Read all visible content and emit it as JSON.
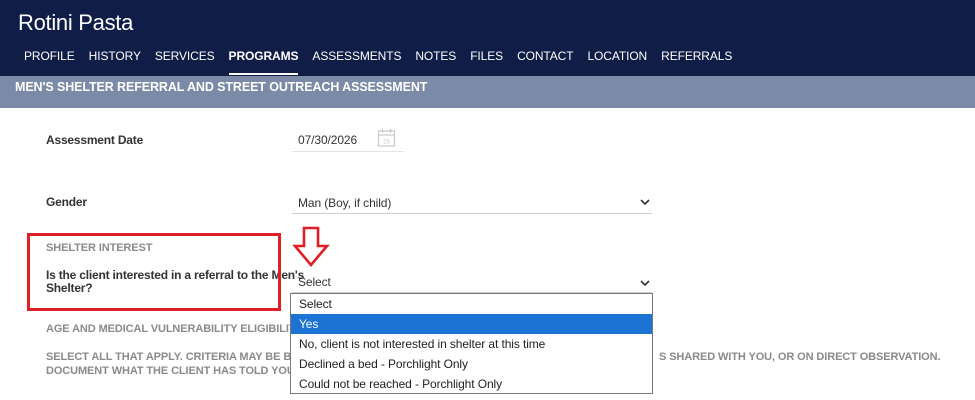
{
  "client": {
    "name": "Rotini Pasta"
  },
  "nav": {
    "items": [
      "PROFILE",
      "HISTORY",
      "SERVICES",
      "PROGRAMS",
      "ASSESSMENTS",
      "NOTES",
      "FILES",
      "CONTACT",
      "LOCATION",
      "REFERRALS"
    ],
    "active": "PROGRAMS"
  },
  "section": {
    "title": "MEN'S SHELTER REFERRAL AND STREET OUTREACH ASSESSMENT"
  },
  "assessment_date": {
    "label": "Assessment Date",
    "value": "07/30/2026",
    "icon": "calendar-icon",
    "icon_day": "25"
  },
  "gender": {
    "label": "Gender",
    "value": "Man (Boy, if child)"
  },
  "shelter_interest": {
    "heading": "SHELTER INTEREST",
    "question_line1": "Is the client interested in a referral to the Men's",
    "question_line2": "Shelter?",
    "value": "Select",
    "options": [
      "Select",
      "Yes",
      "No, client is not interested in shelter at this time",
      "Declined a bed - Porchlight Only",
      "Could not be reached - Porchlight Only"
    ],
    "highlighted_option": "Yes"
  },
  "vulnerability": {
    "heading": "AGE AND MEDICAL VULNERABILITY ELIGIBILITY CR",
    "line1_left": "SELECT ALL THAT APPLY. CRITERIA MAY BE BASED",
    "line1_right": "S SHARED WITH YOU, OR ON DIRECT OBSERVATION.",
    "line2_left": "DOCUMENT WHAT THE CLIENT HAS TOLD YOU OR"
  },
  "colors": {
    "header_bg": "#0f1d47",
    "section_bar": "#7b8aa6",
    "annotation_red": "#e01e26",
    "option_highlight": "#1d73d4"
  }
}
